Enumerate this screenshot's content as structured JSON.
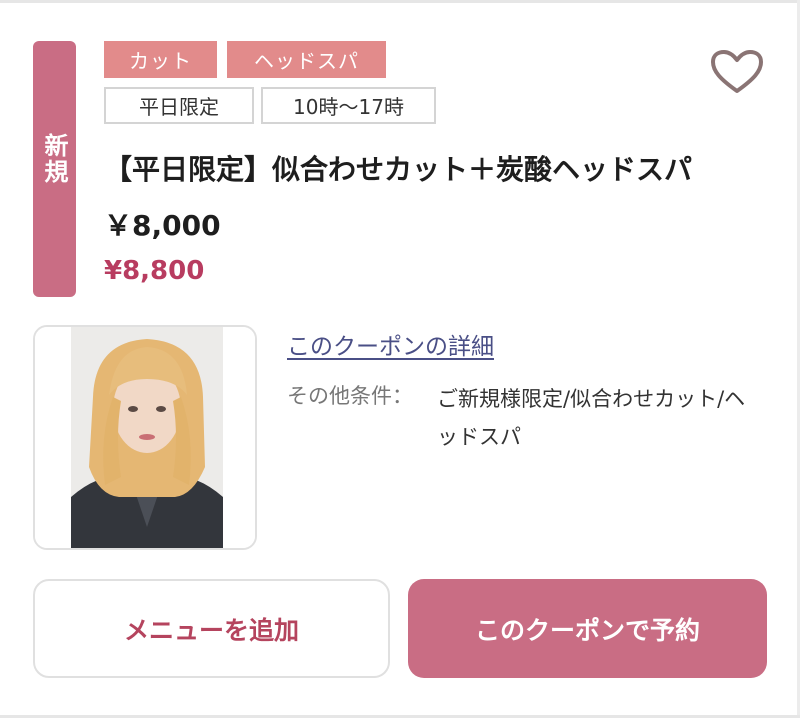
{
  "badge": {
    "new_label": "新規"
  },
  "tags": {
    "category_1": "カット",
    "category_2": "ヘッドスパ",
    "condition_1": "平日限定",
    "condition_2": "10時〜17時"
  },
  "icons": {
    "favorite": "heart-outline-icon"
  },
  "coupon": {
    "title": "【平日限定】似合わせカット＋炭酸ヘッドスパ　￥8,000",
    "price": "¥8,800",
    "detail_link": "このクーポンの詳細",
    "conditions_label": "その他条件：",
    "conditions_value": "ご新規様限定/似合わせカット/ヘッドスパ"
  },
  "actions": {
    "add_menu": "メニューを追加",
    "book": "このクーポンで予約"
  },
  "colors": {
    "accent": "#c96d84",
    "tag": "#e28b8b",
    "price": "#b83c60",
    "link": "#4a4f86"
  }
}
